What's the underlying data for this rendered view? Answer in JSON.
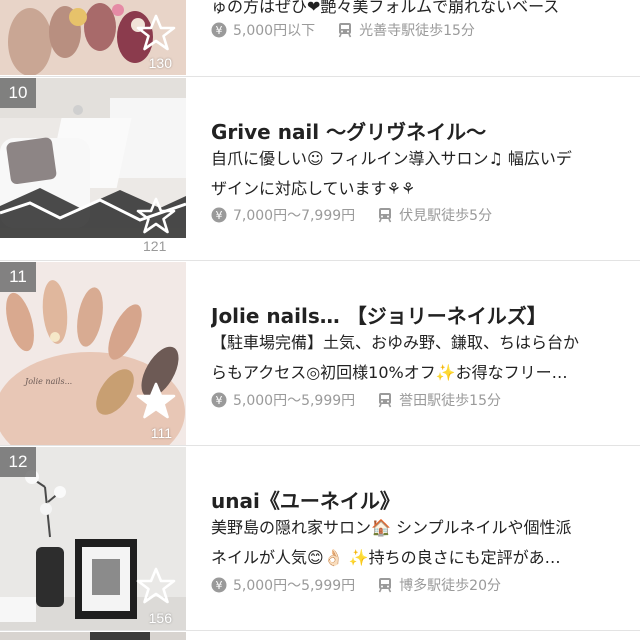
{
  "salons": [
    {
      "rank": "",
      "name": "",
      "catch_line1": "ゅの方はぜひ❤︎艶々美フォルムで崩れないベース",
      "catch_line2": "",
      "price": "5,000円以下",
      "station": "光善寺駅徒歩15分",
      "favorites": "130"
    },
    {
      "rank": "10",
      "name": "Grive nail 〜グリヴネイル〜",
      "catch_line1": "自爪に優しい☺︎ フィルイン導入サロン♫ 幅広いデ",
      "catch_line2": "ザインに対応しています⚘⚘",
      "price": "7,000円〜7,999円",
      "station": "伏見駅徒歩5分",
      "favorites": "121"
    },
    {
      "rank": "11",
      "name": "Jolie nails… 【ジョリーネイルズ】",
      "catch_line1": "【駐車場完備】土気、おゆみ野、鎌取、ちはら台か",
      "catch_line2": "らもアクセス◎初回様10%オフ✨お得なフリー…",
      "price": "5,000円〜5,999円",
      "station": "誉田駅徒歩15分",
      "favorites": "111"
    },
    {
      "rank": "12",
      "name": "unai《ユーネイル》",
      "catch_line1": "美野島の隠れ家サロン🏠 シンプルネイルや個性派",
      "catch_line2": "ネイルが人気😊👌🏻 ✨持ちの良さにも定評があ…",
      "price": "5,000円〜5,999円",
      "station": "博多駅徒歩20分",
      "favorites": "156"
    }
  ],
  "icons": {
    "price": "yen-icon",
    "station": "train-icon",
    "favorite": "star-outline-icon"
  },
  "colors": {
    "meta_text": "#9a9a9a",
    "rank_badge": "#6e6e6e",
    "divider": "#e3e3e3"
  }
}
